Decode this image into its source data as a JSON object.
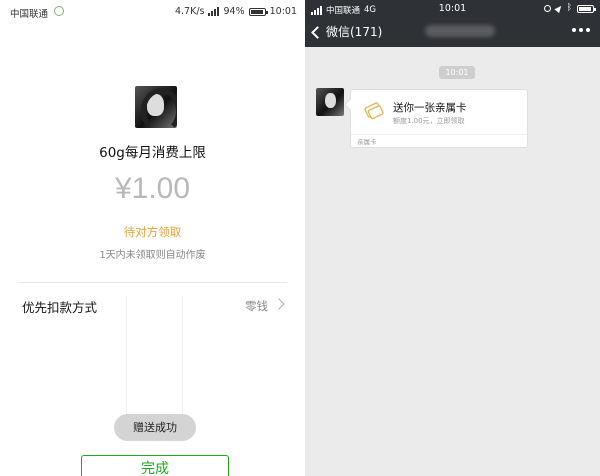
{
  "left_screen": {
    "status_bar": {
      "carrier": "中国联通",
      "net_speed": "4.7K/s",
      "battery": "94%",
      "time": "10:01"
    },
    "gift_title": "60g每月消费上限",
    "amount": "¥1.00",
    "status": "待对方领取",
    "expiry_note": "1天内未领取则自动作废",
    "payment": {
      "label": "优先扣款方式",
      "value": "零钱"
    },
    "toast": "赠送成功",
    "done_label": "完成"
  },
  "right_screen": {
    "status_bar": {
      "carrier": "中国联通",
      "network": "4G",
      "time": "10:01"
    },
    "nav": {
      "back_label": "微信(171)"
    },
    "timestamp": "10:01",
    "card": {
      "title": "送你一张亲属卡",
      "subtitle": "额度1.00元，立即领取",
      "footer": "亲属卡"
    }
  },
  "colors": {
    "accent_green": "#1aad19",
    "pending_orange": "#e6a23c",
    "nav_dark": "#2e3135",
    "chat_bg": "#ebebeb",
    "card_icon_gold": "#e0b64a"
  },
  "icons": [
    "wechat-mini-icon",
    "signal-icon",
    "battery-icon",
    "chevron-right-icon",
    "chevron-left-icon",
    "more-icon",
    "family-card-icon",
    "location-icon",
    "bluetooth-icon",
    "alarm-icon"
  ]
}
